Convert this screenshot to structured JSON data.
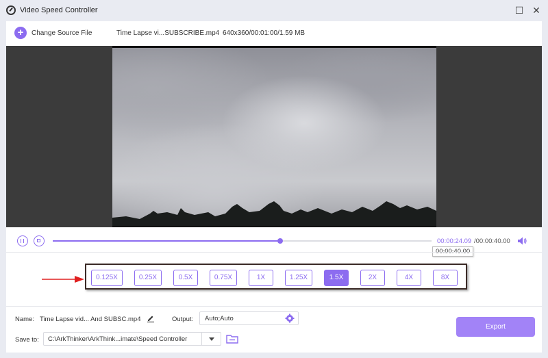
{
  "app": {
    "title": "Video Speed Controller"
  },
  "window": {
    "restore_glyph": "☐",
    "close_glyph": "✕"
  },
  "toolbar": {
    "add_glyph": "+",
    "change_source_label": "Change Source File",
    "file_name": "Time Lapse vi...SUBSCRIBE.mp4",
    "file_meta": "640x360/00:01:00/1.59 MB"
  },
  "playback": {
    "current_time": "00:00:24.09",
    "total_time": "/00:00:40.00",
    "tooltip": "00:00:40.00",
    "progress": 0.6
  },
  "speeds": {
    "options": [
      "0.125X",
      "0.25X",
      "0.5X",
      "0.75X",
      "1X",
      "1.25X",
      "1.5X",
      "2X",
      "4X",
      "8X"
    ],
    "selected": "1.5X"
  },
  "output_settings": {
    "name_label": "Name:",
    "name_value": "Time Lapse vid... And SUBSC.mp4",
    "output_label": "Output:",
    "output_value": "Auto;Auto",
    "save_label": "Save to:",
    "save_path": "C:\\ArkThinker\\ArkThink...imate\\Speed Controller",
    "export_label": "Export"
  },
  "colors": {
    "accent": "#8c6cf0",
    "export": "#a283f7",
    "annotation_arrow": "#e02020"
  },
  "icons": [
    "app-speed-icon",
    "add-icon",
    "pause-icon",
    "stop-icon",
    "volume-icon",
    "edit-icon",
    "gear-icon",
    "dropdown-arrow-icon",
    "folder-icon"
  ]
}
